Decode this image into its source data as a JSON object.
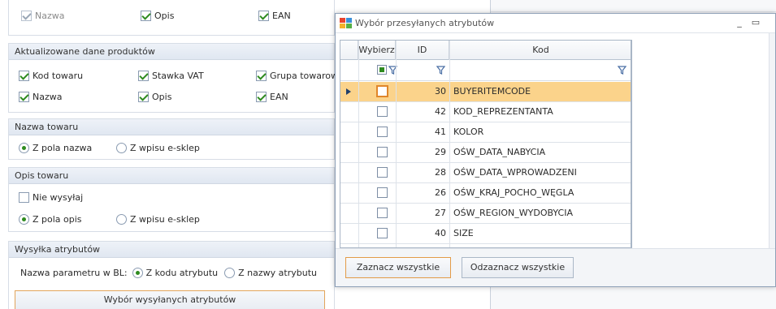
{
  "left_panel": {
    "top_row": {
      "nazwa": "Nazwa",
      "opis": "Opis",
      "ean": "EAN"
    },
    "updated_data": {
      "title": "Aktualizowane dane produktów",
      "kod_towaru": "Kod towaru",
      "stawka_vat": "Stawka VAT",
      "grupa_towarowa": "Grupa towarowa",
      "nazwa": "Nazwa",
      "opis": "Opis",
      "ean": "EAN"
    },
    "product_name": {
      "title": "Nazwa towaru",
      "option1": "Z pola nazwa",
      "option2": "Z wpisu e-sklep"
    },
    "product_description": {
      "title": "Opis towaru",
      "nie_wysylaj": "Nie wysyłaj",
      "option1": "Z pola opis",
      "option2": "Z wpisu e-sklep"
    },
    "attributes": {
      "title": "Wysyłka atrybutów",
      "param_label": "Nazwa parametru w BL:",
      "option1": "Z kodu atrybutu",
      "option2": "Z nazwy atrybutu",
      "button": "Wybór wysyłanych atrybutów"
    }
  },
  "dialog": {
    "title": "Wybór przesyłanych atrybutów",
    "minimize": "_",
    "maximize": "▭",
    "columns": {
      "wybierz": "Wybierz",
      "id": "ID",
      "kod": "Kod"
    },
    "rows": [
      {
        "id": "30",
        "kod": "BUYERITEMCODE"
      },
      {
        "id": "42",
        "kod": "KOD_REPREZENTANTA"
      },
      {
        "id": "41",
        "kod": "KOLOR"
      },
      {
        "id": "29",
        "kod": "OŚW_DATA_NABYCIA"
      },
      {
        "id": "28",
        "kod": "OŚW_DATA_WPROWADZENI"
      },
      {
        "id": "26",
        "kod": "OŚW_KRAJ_POCHO_WĘGLA"
      },
      {
        "id": "27",
        "kod": "OŚW_REGION_WYDOBYCIA"
      },
      {
        "id": "40",
        "kod": "SIZE"
      }
    ],
    "select_all": "Zaznacz wszystkie",
    "deselect_all": "Odzaznacz wszystkie"
  },
  "colors": {
    "selected_row": "#fbd38b",
    "check_green": "#2e8b1f",
    "focus_orange": "#e0862a",
    "filter_blue": "#4a6fa5"
  }
}
